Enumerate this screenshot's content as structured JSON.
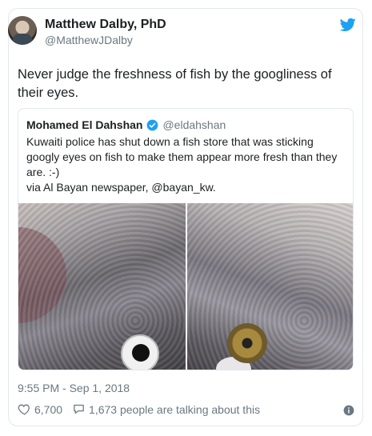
{
  "author": {
    "name": "Matthew Dalby, PhD",
    "handle": "@MatthewJDalby"
  },
  "tweet": {
    "text": "Never judge the freshness of fish by the googliness of their eyes."
  },
  "quoted": {
    "name": "Mohamed El Dahshan",
    "handle": "@eldahshan",
    "text": "Kuwaiti police has shut down a fish store that was sticking googly eyes on fish to make them appear more fresh than they are. :-)\nvia Al Bayan newspaper, @bayan_kw."
  },
  "meta": {
    "timestamp": "9:55 PM - Sep 1, 2018",
    "likes": "6,700",
    "replies_text": "1,673 people are talking about this"
  },
  "colors": {
    "twitter_blue": "#1da1f2",
    "muted": "#697882"
  },
  "icons": [
    "twitter-bird-icon",
    "verified-icon",
    "heart-icon",
    "comment-icon",
    "info-icon"
  ]
}
